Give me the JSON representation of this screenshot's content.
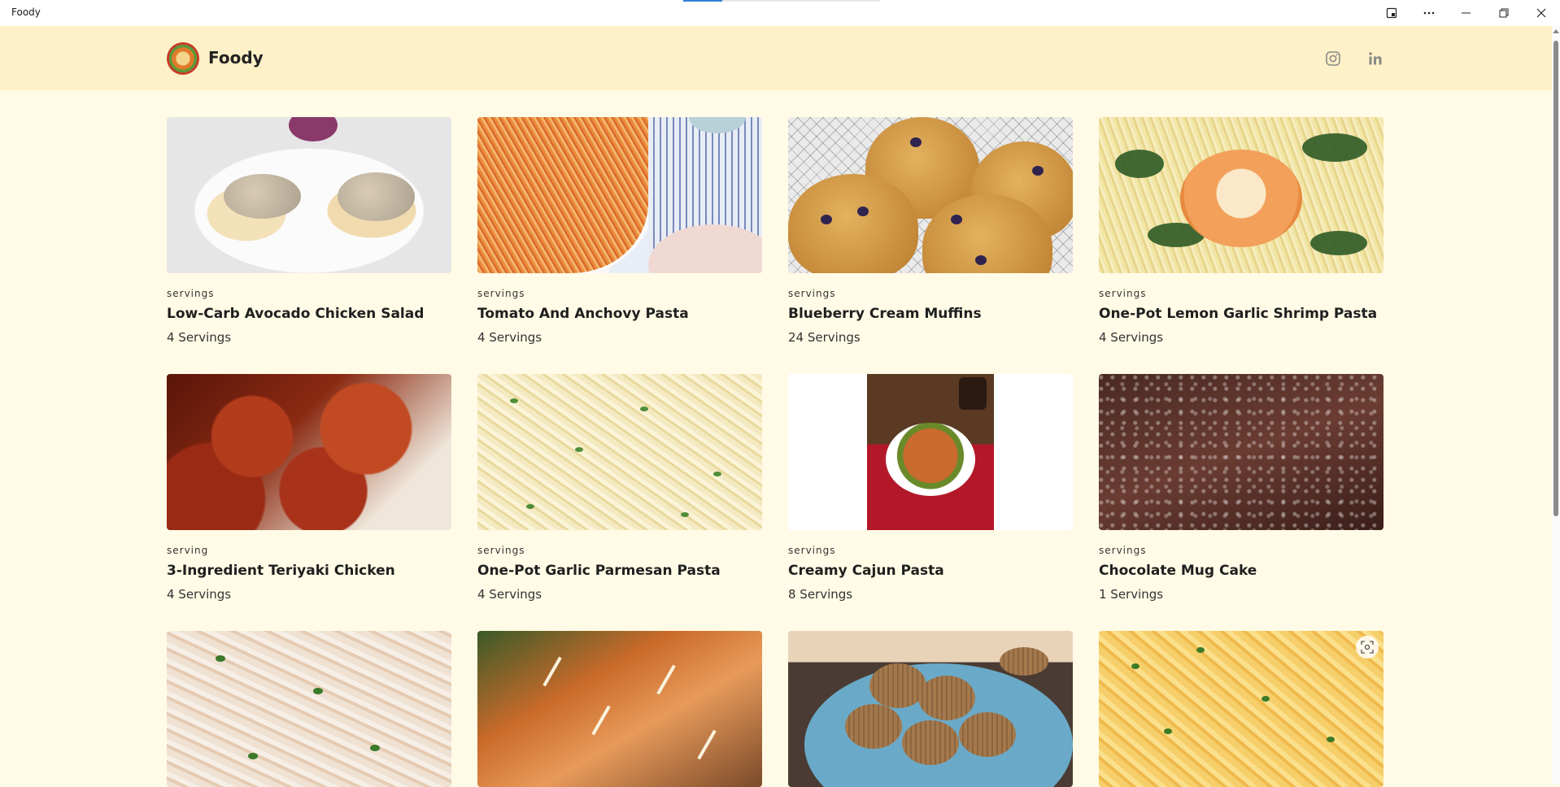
{
  "window": {
    "title": "Foody"
  },
  "header": {
    "brand": "Foody",
    "social": [
      "instagram-icon",
      "linkedin-icon"
    ]
  },
  "recipes": [
    {
      "label": "servings",
      "title": "Low-Carb Avocado Chicken Salad",
      "servings": "4 Servings"
    },
    {
      "label": "servings",
      "title": "Tomato And Anchovy Pasta",
      "servings": "4 Servings"
    },
    {
      "label": "servings",
      "title": "Blueberry Cream Muffins",
      "servings": "24 Servings"
    },
    {
      "label": "servings",
      "title": "One-Pot Lemon Garlic Shrimp Pasta",
      "servings": "4 Servings"
    },
    {
      "label": "serving",
      "title": "3-Ingredient Teriyaki Chicken",
      "servings": "4 Servings"
    },
    {
      "label": "servings",
      "title": "One-Pot Garlic Parmesan Pasta",
      "servings": "4 Servings"
    },
    {
      "label": "servings",
      "title": "Creamy Cajun Pasta",
      "servings": "8 Servings"
    },
    {
      "label": "servings",
      "title": "Chocolate Mug Cake",
      "servings": "1 Servings"
    }
  ],
  "colors": {
    "page_background": "#fffbe6",
    "header_background": "#fff1c7",
    "accent": "#2f7fd6"
  }
}
